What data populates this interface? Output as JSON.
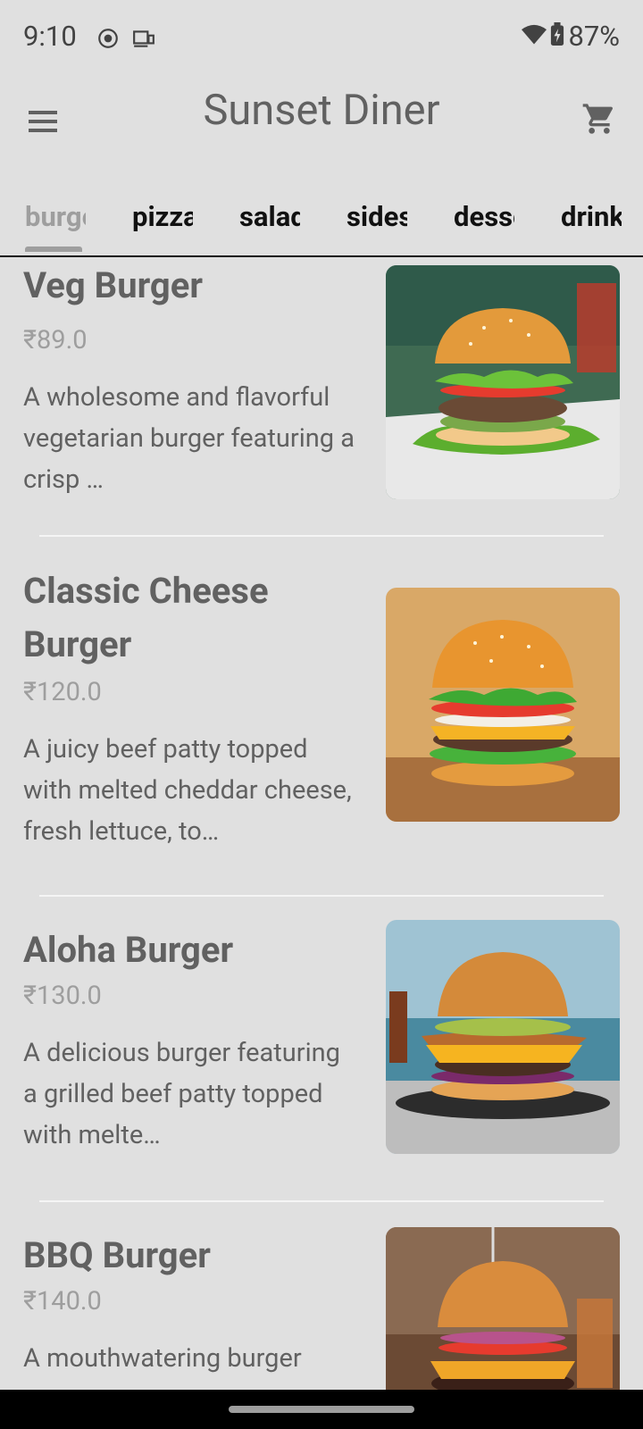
{
  "status": {
    "time": "9:10",
    "battery": "87%"
  },
  "app": {
    "title": "Sunset Diner"
  },
  "tabs": [
    "burgers",
    "pizza",
    "salads",
    "sides",
    "desserts",
    "drinks"
  ],
  "menu_items": [
    {
      "name": "Veg Burger",
      "price": "₹89.0",
      "description": "A wholesome and flavorful vegetarian burger featuring a crisp …"
    },
    {
      "name": "Classic Cheese Burger",
      "price": "₹120.0",
      "description": "A juicy beef patty topped with melted cheddar cheese, fresh lettuce, to…"
    },
    {
      "name": "Aloha Burger",
      "price": "₹130.0",
      "description": "A delicious burger featuring a grilled beef patty topped with melte…"
    },
    {
      "name": "BBQ Burger",
      "price": "₹140.0",
      "description": "A mouthwatering burger"
    }
  ],
  "icons": {
    "menu": "menu-icon",
    "cart": "cart-icon",
    "wifi": "wifi-icon",
    "battery": "battery-icon"
  }
}
